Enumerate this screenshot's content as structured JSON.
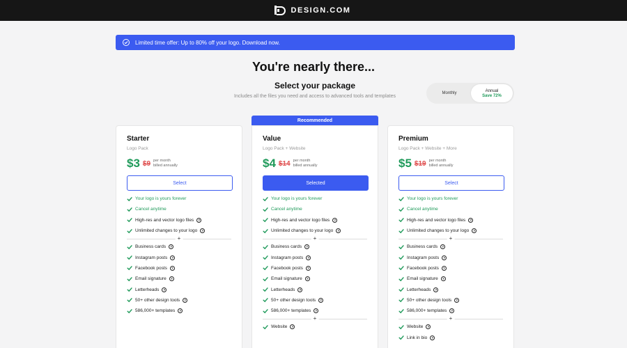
{
  "brand": {
    "name": "DESIGN.COM"
  },
  "banner": {
    "text": "Limited time offer: Up to 80% off your logo. Download now."
  },
  "header": {
    "title": "You're nearly there...",
    "subtitle": "Select your package",
    "description": "Includes all the files you need and access to advanced tools and templates"
  },
  "billing_toggle": {
    "monthly": "Monthly",
    "annual": "Annual",
    "annual_note": "Save 72%",
    "selected": "Annual"
  },
  "recommended_label": "Recommended",
  "colors": {
    "accent": "#3b5bf0",
    "price_green": "#1f9a5a",
    "strike_red": "#e05252"
  },
  "plans": [
    {
      "name": "Starter",
      "includes": "Logo Pack",
      "price": "$3",
      "old_price": "$9",
      "per_line1": "per month",
      "per_line2": "billed annually",
      "button": "Select",
      "core": [
        {
          "label": "Your logo is yours forever",
          "green": true,
          "info": false
        },
        {
          "label": "Cancel anytime",
          "green": true,
          "info": false
        },
        {
          "label": "High-res and vector logo files",
          "green": false,
          "info": true
        },
        {
          "label": "Unlimited changes to your logo",
          "green": false,
          "info": true
        }
      ],
      "tools": [
        {
          "label": "Business cards",
          "info": true
        },
        {
          "label": "Instagram posts",
          "info": true
        },
        {
          "label": "Facebook posts",
          "info": true
        },
        {
          "label": "Email signature",
          "info": true
        },
        {
          "label": "Letterheads",
          "info": true
        },
        {
          "label": "50+ other design tools",
          "info": true
        },
        {
          "label": "586,000+ templates",
          "info": true
        }
      ],
      "extras": []
    },
    {
      "name": "Value",
      "includes": "Logo Pack + Website",
      "price": "$4",
      "old_price": "$14",
      "per_line1": "per month",
      "per_line2": "billed annually",
      "button": "Selected",
      "core": [
        {
          "label": "Your logo is yours forever",
          "green": true,
          "info": false
        },
        {
          "label": "Cancel anytime",
          "green": true,
          "info": false
        },
        {
          "label": "High-res and vector logo files",
          "green": false,
          "info": true
        },
        {
          "label": "Unlimited changes to your logo",
          "green": false,
          "info": true
        }
      ],
      "tools": [
        {
          "label": "Business cards",
          "info": true
        },
        {
          "label": "Instagram posts",
          "info": true
        },
        {
          "label": "Facebook posts",
          "info": true
        },
        {
          "label": "Email signature",
          "info": true
        },
        {
          "label": "Letterheads",
          "info": true
        },
        {
          "label": "50+ other design tools",
          "info": true
        },
        {
          "label": "586,000+ templates",
          "info": true
        }
      ],
      "extras": [
        {
          "label": "Website",
          "info": true
        }
      ]
    },
    {
      "name": "Premium",
      "includes": "Logo Pack + Website + More",
      "price": "$5",
      "old_price": "$19",
      "per_line1": "per month",
      "per_line2": "billed annually",
      "button": "Select",
      "core": [
        {
          "label": "Your logo is yours forever",
          "green": true,
          "info": false
        },
        {
          "label": "Cancel anytime",
          "green": true,
          "info": false
        },
        {
          "label": "High-res and vector logo files",
          "green": false,
          "info": true
        },
        {
          "label": "Unlimited changes to your logo",
          "green": false,
          "info": true
        }
      ],
      "tools": [
        {
          "label": "Business cards",
          "info": true
        },
        {
          "label": "Instagram posts",
          "info": true
        },
        {
          "label": "Facebook posts",
          "info": true
        },
        {
          "label": "Email signature",
          "info": true
        },
        {
          "label": "Letterheads",
          "info": true
        },
        {
          "label": "50+ other design tools",
          "info": true
        },
        {
          "label": "586,000+ templates",
          "info": true
        }
      ],
      "extras": [
        {
          "label": "Website",
          "info": true
        },
        {
          "label": "Link in bio",
          "info": true
        }
      ]
    }
  ]
}
